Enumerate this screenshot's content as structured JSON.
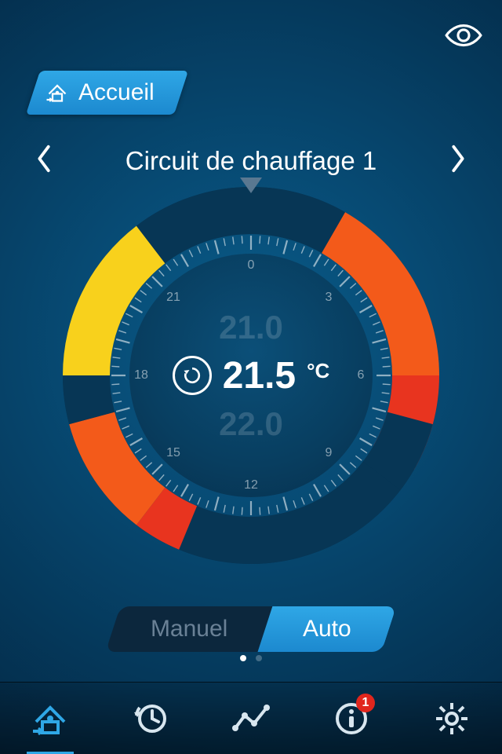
{
  "colors": {
    "accent": "#2fa7e6",
    "warn_red": "#e8341f",
    "warn_orange": "#f35a1a",
    "warn_yellow": "#f8d11c",
    "dark_navy": "#073655",
    "badge_red": "#e1261d"
  },
  "header": {
    "home_label": "Accueil"
  },
  "circuit": {
    "name": "Circuit de chauffage 1"
  },
  "dial": {
    "prev_temp": "21.0",
    "next_temp": "22.0",
    "current_temp": "21.5",
    "unit": "°C",
    "hours": [
      "0",
      "3",
      "6",
      "9",
      "12",
      "15",
      "18",
      "21"
    ],
    "segments": [
      {
        "start": 2,
        "end": 6,
        "color": "warn_orange"
      },
      {
        "start": 6,
        "end": 8,
        "color": "warn_red"
      },
      {
        "start": 7,
        "end": 8.5,
        "color": "dark_navy"
      },
      {
        "start": 8.5,
        "end": 17,
        "color": "dark_navy"
      },
      {
        "start": 13.5,
        "end": 14.5,
        "color": "warn_red"
      },
      {
        "start": 14.5,
        "end": 17,
        "color": "warn_orange"
      },
      {
        "start": 17,
        "end": 18,
        "color": "dark_navy"
      },
      {
        "start": 18,
        "end": 21.5,
        "color": "warn_yellow"
      },
      {
        "start": 21.5,
        "end": 26,
        "color": "dark_navy"
      }
    ]
  },
  "mode_toggle": {
    "option_manual": "Manuel",
    "option_auto": "Auto",
    "active": "auto"
  },
  "pager": {
    "count": 2,
    "active": 0
  },
  "nav": {
    "items": [
      {
        "id": "home",
        "icon": "home-temp-icon",
        "active": true,
        "badge": null
      },
      {
        "id": "schedule",
        "icon": "clock-arrow-icon",
        "active": false,
        "badge": null
      },
      {
        "id": "graph",
        "icon": "graph-icon",
        "active": false,
        "badge": null
      },
      {
        "id": "info",
        "icon": "info-icon",
        "active": false,
        "badge": "1"
      },
      {
        "id": "settings",
        "icon": "gear-icon",
        "active": false,
        "badge": null
      }
    ]
  }
}
